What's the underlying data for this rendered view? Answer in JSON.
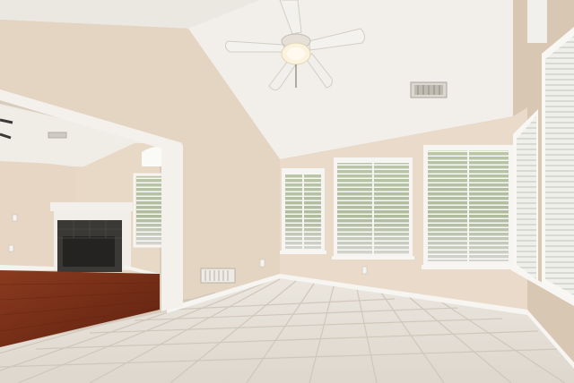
{
  "scene": {
    "colors": {
      "ceiling": "#eeebe6",
      "ceiling_shade": "#e2ddd6",
      "wall_left": "#e3d3c1",
      "wall_back": "#e8d9c8",
      "wall_right": "#d8c6b2",
      "trim": "#f7f5f1",
      "tile_floor": "#e4dfd7",
      "tile_grout": "#cfc8bd",
      "wood_floor": "#7a2f18",
      "fireplace_surround": "#f1eee9",
      "fireplace_firebox": "#2f2d2b",
      "greenery": "#5f7a3a",
      "blind": "#f3f3f0"
    },
    "icons": [
      "ceiling-fan-icon",
      "air-vent-icon",
      "outlet-icon"
    ]
  }
}
